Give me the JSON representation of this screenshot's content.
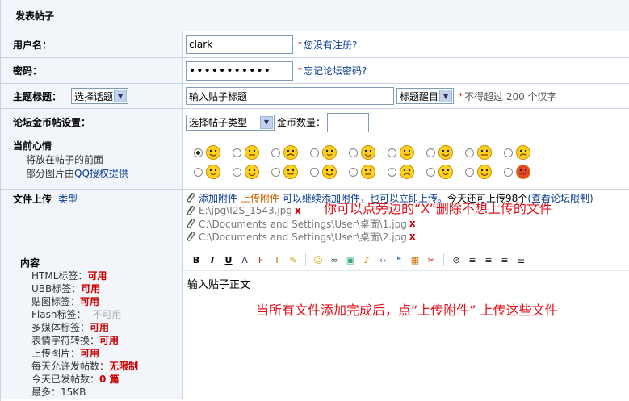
{
  "header": {
    "title": "发表帖子"
  },
  "username": {
    "label": "用户名：",
    "value": "clark",
    "star": "*",
    "link": "您没有注册?"
  },
  "password": {
    "label": "密码：",
    "value": "•••••••••••",
    "star": "*",
    "link": "忘记论坛密码?"
  },
  "subject": {
    "label": "主题标题：",
    "topic_select": "选择话题",
    "title_value": "输入贴子标题",
    "highlight_select": "标题醒目",
    "star": "*",
    "note": "不得超过 200 个汉字"
  },
  "coin": {
    "label": "论坛金币帖设置：",
    "type_select": "选择帖子类型",
    "amount_label": "金币数量："
  },
  "mood": {
    "label": "当前心情",
    "desc1": "将放在帖子的前面",
    "desc2_prefix": "部分图片由",
    "desc2_link": "QQ授权提供"
  },
  "upload": {
    "label": "文件上传",
    "type_link": "类型",
    "add_link": "添加附件",
    "upload_link": "上传附件",
    "info_blue": "可以继续添加附件，也可以立即上传。",
    "info_black": "今天还可上传98个",
    "limit_link": "(查看论坛限制)",
    "files": [
      "E:\\jpg\\I2S_1543.jpg",
      "C:\\Documents and Settings\\User\\桌面\\1.jpg",
      "C:\\Documents and Settings\\User\\桌面\\2.jpg"
    ],
    "delete_mark": "x",
    "annotation": "你可以点旁边的“X”删除不想上传的文件"
  },
  "content": {
    "label": "内容",
    "settings": [
      {
        "name": "HTML标签：",
        "value": "可用"
      },
      {
        "name": "UBB标签：",
        "value": "可用"
      },
      {
        "name": "贴图标签：",
        "value": "可用"
      },
      {
        "name": "Flash标签：",
        "value": "不可用"
      },
      {
        "name": "多媒体标签：",
        "value": "可用"
      },
      {
        "name": "表情字符转换：",
        "value": "可用"
      },
      {
        "name": "上传图片：",
        "value": "可用"
      },
      {
        "name": "每天允许发帖数：",
        "value": "无限制"
      },
      {
        "name": "今天已发帖数：",
        "value": "0 篇"
      },
      {
        "name": "最多：",
        "value": "15KB"
      }
    ],
    "editor_text": "输入贴子正文",
    "annotation": "当所有文件添加完成后，点“上传附件” 上传这些文件",
    "toolbar": [
      "bold-icon",
      "italic-icon",
      "underline-icon",
      "font-size-icon",
      "font-face-icon",
      "text-color-icon",
      "highlight-icon",
      "smiley-icon",
      "link-icon",
      "image-icon",
      "flash-icon",
      "code-icon",
      "quote-icon",
      "table-icon",
      "clear-format-icon",
      "unlink-icon",
      "align-left-icon",
      "align-center-icon",
      "align-right-icon",
      "list-icon"
    ]
  },
  "colors": {
    "accent": "#0b3d91",
    "border": "#c8d4e6",
    "label_bg": "#f2f6fb",
    "red": "#e0111a"
  }
}
